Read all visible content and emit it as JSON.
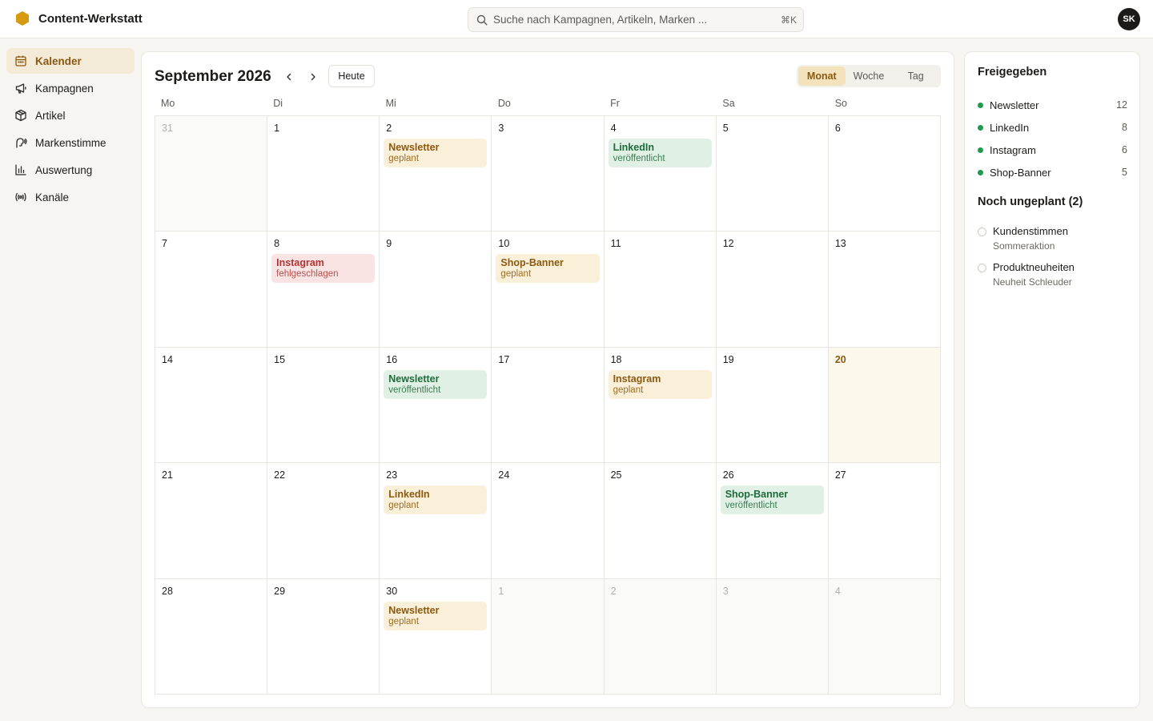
{
  "app": {
    "name": "Content-Werkstatt",
    "brand_color": "#d59a10",
    "accent_color": "#8a5a10"
  },
  "search": {
    "placeholder": "Suche nach Kampagnen, Artikeln, Marken ...",
    "shortcut": "⌘K"
  },
  "user": {
    "initials": "SK"
  },
  "sidebar": {
    "items": [
      {
        "label": "Kalender",
        "icon": "calendar-icon",
        "active": true
      },
      {
        "label": "Kampagnen",
        "icon": "megaphone-icon",
        "active": false
      },
      {
        "label": "Artikel",
        "icon": "box-icon",
        "active": false
      },
      {
        "label": "Markenstimme",
        "icon": "voice-icon",
        "active": false
      },
      {
        "label": "Auswertung",
        "icon": "bar-chart-icon",
        "active": false
      },
      {
        "label": "Kanäle",
        "icon": "broadcast-icon",
        "active": false
      }
    ]
  },
  "calendar": {
    "title": "September 2026",
    "today_label": "Heute",
    "views": [
      {
        "label": "Monat",
        "active": true
      },
      {
        "label": "Woche",
        "active": false
      },
      {
        "label": "Tag",
        "active": false
      }
    ],
    "weekdays": [
      "Mo",
      "Di",
      "Mi",
      "Do",
      "Fr",
      "Sa",
      "So"
    ],
    "days": [
      {
        "num": "31",
        "other": true
      },
      {
        "num": "1"
      },
      {
        "num": "2",
        "events": [
          {
            "title": "Newsletter",
            "status": "geplant",
            "kind": "planned"
          }
        ]
      },
      {
        "num": "3"
      },
      {
        "num": "4",
        "events": [
          {
            "title": "LinkedIn",
            "status": "veröffentlicht",
            "kind": "published"
          }
        ]
      },
      {
        "num": "5"
      },
      {
        "num": "6"
      },
      {
        "num": "7"
      },
      {
        "num": "8",
        "events": [
          {
            "title": "Instagram",
            "status": "fehlgeschlagen",
            "kind": "failed"
          }
        ]
      },
      {
        "num": "9"
      },
      {
        "num": "10",
        "events": [
          {
            "title": "Shop-Banner",
            "status": "geplant",
            "kind": "planned"
          }
        ]
      },
      {
        "num": "11"
      },
      {
        "num": "12"
      },
      {
        "num": "13"
      },
      {
        "num": "14"
      },
      {
        "num": "15"
      },
      {
        "num": "16",
        "events": [
          {
            "title": "Newsletter",
            "status": "veröffentlicht",
            "kind": "published"
          }
        ]
      },
      {
        "num": "17"
      },
      {
        "num": "18",
        "events": [
          {
            "title": "Instagram",
            "status": "geplant",
            "kind": "planned"
          }
        ]
      },
      {
        "num": "19"
      },
      {
        "num": "20",
        "today": true
      },
      {
        "num": "21"
      },
      {
        "num": "22"
      },
      {
        "num": "23",
        "events": [
          {
            "title": "LinkedIn",
            "status": "geplant",
            "kind": "planned"
          }
        ]
      },
      {
        "num": "24"
      },
      {
        "num": "25"
      },
      {
        "num": "26",
        "events": [
          {
            "title": "Shop-Banner",
            "status": "veröffentlicht",
            "kind": "published"
          }
        ]
      },
      {
        "num": "27"
      },
      {
        "num": "28"
      },
      {
        "num": "29"
      },
      {
        "num": "30",
        "events": [
          {
            "title": "Newsletter",
            "status": "geplant",
            "kind": "planned"
          }
        ]
      },
      {
        "num": "1",
        "other": true
      },
      {
        "num": "2",
        "other": true
      },
      {
        "num": "3",
        "other": true
      },
      {
        "num": "4",
        "other": true
      }
    ]
  },
  "approved": {
    "title": "Freigegeben",
    "items": [
      {
        "name": "Newsletter",
        "count": "12"
      },
      {
        "name": "LinkedIn",
        "count": "8"
      },
      {
        "name": "Instagram",
        "count": "6"
      },
      {
        "name": "Shop-Banner",
        "count": "5"
      }
    ]
  },
  "unplanned": {
    "title": "Noch ungeplant (2)",
    "items": [
      {
        "name": "Kundenstimmen",
        "sub": "Sommeraktion"
      },
      {
        "name": "Produktneuheiten",
        "sub": "Neuheit Schleuder"
      }
    ]
  }
}
